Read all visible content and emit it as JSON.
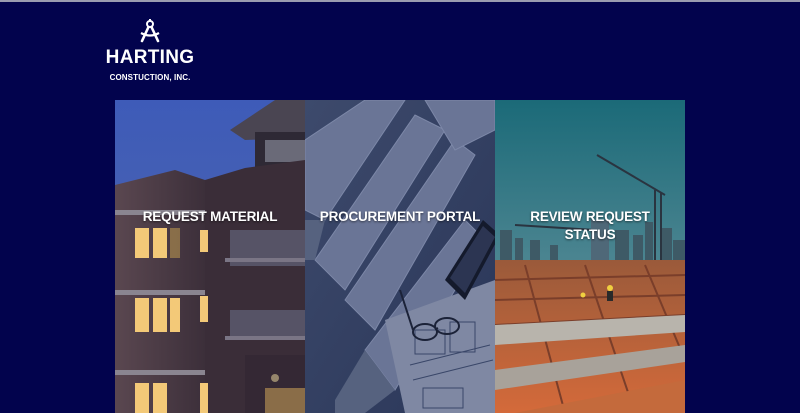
{
  "brand": {
    "name": "HARTING",
    "subtitle": "CONSTUCTION, INC.",
    "icon": "compass-icon"
  },
  "tiles": [
    {
      "label": "REQUEST MATERIAL",
      "image": "apartment-building"
    },
    {
      "label": "PROCUREMENT PORTAL",
      "image": "blueprints"
    },
    {
      "label": "REVIEW REQUEST STATUS",
      "image": "construction-site-crane"
    }
  ],
  "colors": {
    "background": "#02034d",
    "text": "#ffffff"
  }
}
